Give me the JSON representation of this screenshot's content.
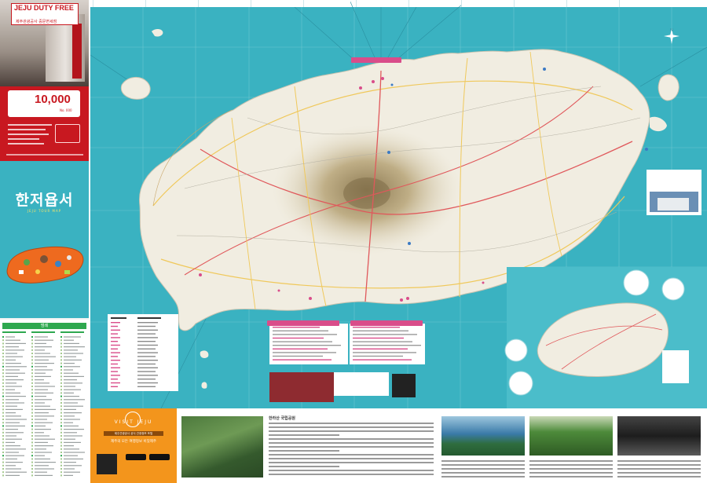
{
  "duty_free": {
    "logo": "JEJU DUTY FREE",
    "logo_sub": "제주관광공사 중문면세점",
    "amount": "10,000",
    "number": "No. 000"
  },
  "cover": {
    "title": "한저욥서",
    "subtitle": "JEJU TOUR MAP"
  },
  "index": {
    "heading": "범례"
  },
  "visit_jeju": {
    "title": "VISIT JEJU",
    "tag": "제주관광공사 공식 관광정보 포털",
    "text": "제주의 모든 여행정보 비짓제주"
  },
  "bottom": {
    "trail_title": "한라산 국립공원"
  },
  "colors": {
    "sea": "#3ab2c1",
    "land": "#f1ede1",
    "mountain": "#b8a47e",
    "road_main": "#e0585b",
    "road_minor": "#f0c85a",
    "label_pink": "#d94d8a",
    "visit_jeju": "#f3951c",
    "duty_free": "#c81820"
  }
}
